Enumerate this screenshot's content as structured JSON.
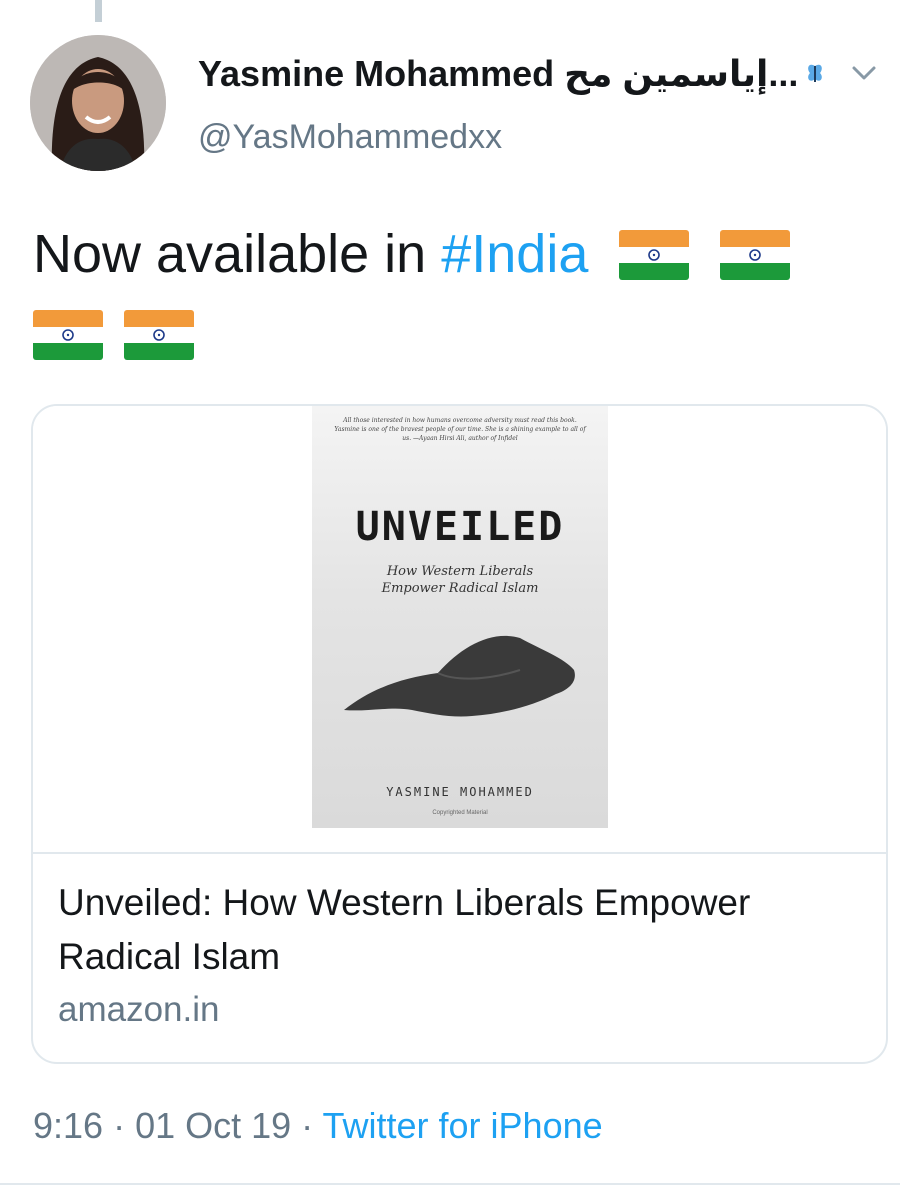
{
  "tweet": {
    "author": {
      "display_name": "Yasmine Mohammed إياسمين مح...",
      "handle": "@YasMohammedxx",
      "avatar_icon": "avatar-photo"
    },
    "text_prefix": "Now available in ",
    "hashtag": "#India",
    "flag_icon": "india-flag-emoji",
    "meta": {
      "time": "9:16",
      "separator": " · ",
      "date": "01 Oct 19",
      "source": "Twitter for iPhone"
    }
  },
  "card": {
    "book": {
      "blurb": "All those interested in how humans overcome adversity must read this book. Yasmine is one of the bravest people of our time. She is a shining example to all of us. —Ayaan Hirsi Ali, author of Infidel",
      "title": "UNVEILED",
      "subtitle_line1": "How Western Liberals",
      "subtitle_line2": "Empower Radical Islam",
      "author": "YASMINE MOHAMMED",
      "copyright": "Copyrighted Material"
    },
    "title": "Unveiled: How Western Liberals Empower Radical Islam",
    "domain": "amazon.in"
  },
  "colors": {
    "link": "#1da1f2",
    "secondary_text": "#657786",
    "border": "#e1e8ed"
  }
}
